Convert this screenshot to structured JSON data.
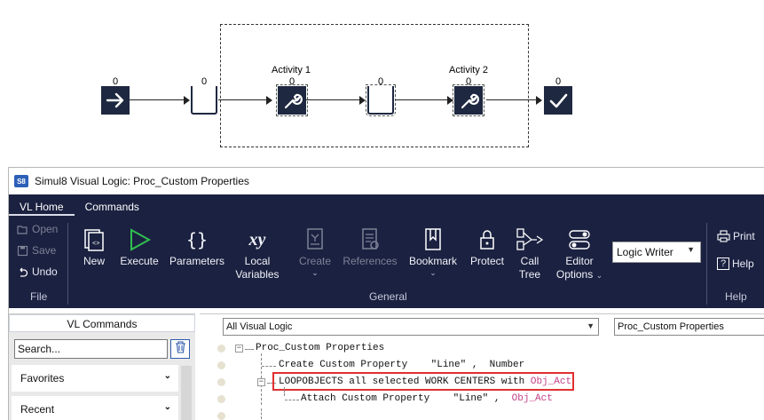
{
  "diagram": {
    "counts": [
      "0",
      "0",
      "0",
      "0",
      "0",
      "0"
    ],
    "activities": [
      {
        "label": "Activity 1"
      },
      {
        "label": "Activity 2"
      }
    ],
    "icons": [
      "entry-arrow-icon",
      "queue-icon",
      "wrench-icon",
      "queue-icon",
      "wrench-icon",
      "exit-check-icon"
    ]
  },
  "window": {
    "title": "Simul8 Visual Logic: Proc_Custom Properties",
    "badge": "S8"
  },
  "ribbon": {
    "tabs": [
      {
        "label": "VL Home",
        "active": true
      },
      {
        "label": "Commands",
        "active": false
      }
    ],
    "file_group": {
      "label": "File",
      "buttons": [
        {
          "label": "Open",
          "icon": "open-icon",
          "enabled": false
        },
        {
          "label": "Save",
          "icon": "save-icon",
          "enabled": false
        },
        {
          "label": "Undo",
          "icon": "undo-icon",
          "enabled": true
        }
      ]
    },
    "general_group": {
      "label": "General",
      "buttons": [
        {
          "label": "New",
          "icon": "new-icon",
          "enabled": true
        },
        {
          "label": "Execute",
          "icon": "play-icon",
          "enabled": true
        },
        {
          "label": "Parameters",
          "icon": "braces-icon",
          "enabled": true
        },
        {
          "label": "Local Variables",
          "line1": "Local",
          "line2": "Variables",
          "icon": "xy-icon",
          "enabled": true
        },
        {
          "label": "Create",
          "icon": "create-icon",
          "enabled": false
        },
        {
          "label": "References",
          "icon": "references-icon",
          "enabled": false
        },
        {
          "label": "Bookmark",
          "icon": "bookmark-icon",
          "enabled": true
        },
        {
          "label": "Protect",
          "icon": "lock-icon",
          "enabled": true
        },
        {
          "label": "Call Tree",
          "line1": "Call",
          "line2": "Tree",
          "icon": "call-tree-icon",
          "enabled": true
        },
        {
          "label": "Editor Options",
          "line1": "Editor",
          "line2": "Options",
          "icon": "toggle-icon",
          "enabled": true
        }
      ],
      "xy_glyph": "xy",
      "braces_glyph": "{}",
      "dropdown_value": "Logic Writer"
    },
    "help_group": {
      "label": "Help",
      "buttons": [
        {
          "label": "Print",
          "icon": "print-icon"
        },
        {
          "label": "Help",
          "icon": "help-icon",
          "glyph": "?"
        }
      ]
    }
  },
  "left_pane": {
    "title": "VL Commands",
    "search_value": "Search...",
    "categories": [
      "Favorites",
      "Recent"
    ]
  },
  "right_pane": {
    "scope_value": "All Visual Logic",
    "section_value": "Proc_Custom Properties",
    "code_lines": [
      {
        "parts": [
          {
            "text": "Proc_Custom Properties",
            "color": "normal"
          }
        ]
      },
      {
        "parts": [
          {
            "text": "Create Custom Property    \"Line\" ,  Number",
            "color": "normal"
          }
        ]
      },
      {
        "parts": [
          {
            "text": "LOOPOBJECTS all selected WORK CENTERS with ",
            "color": "normal"
          },
          {
            "text": "Obj_Act",
            "color": "pink"
          }
        ]
      },
      {
        "parts": [
          {
            "text": "Attach Custom Property    \"Line\" ,  ",
            "color": "normal"
          },
          {
            "text": "Obj_Act",
            "color": "pink"
          }
        ]
      }
    ]
  },
  "colors": {
    "ribbon_bg": "#1b2140",
    "node_bg": "#1e2840",
    "execute_green": "#2fbf4f",
    "highlight_red": "#e03030",
    "variable_pink": "#c2418a"
  }
}
